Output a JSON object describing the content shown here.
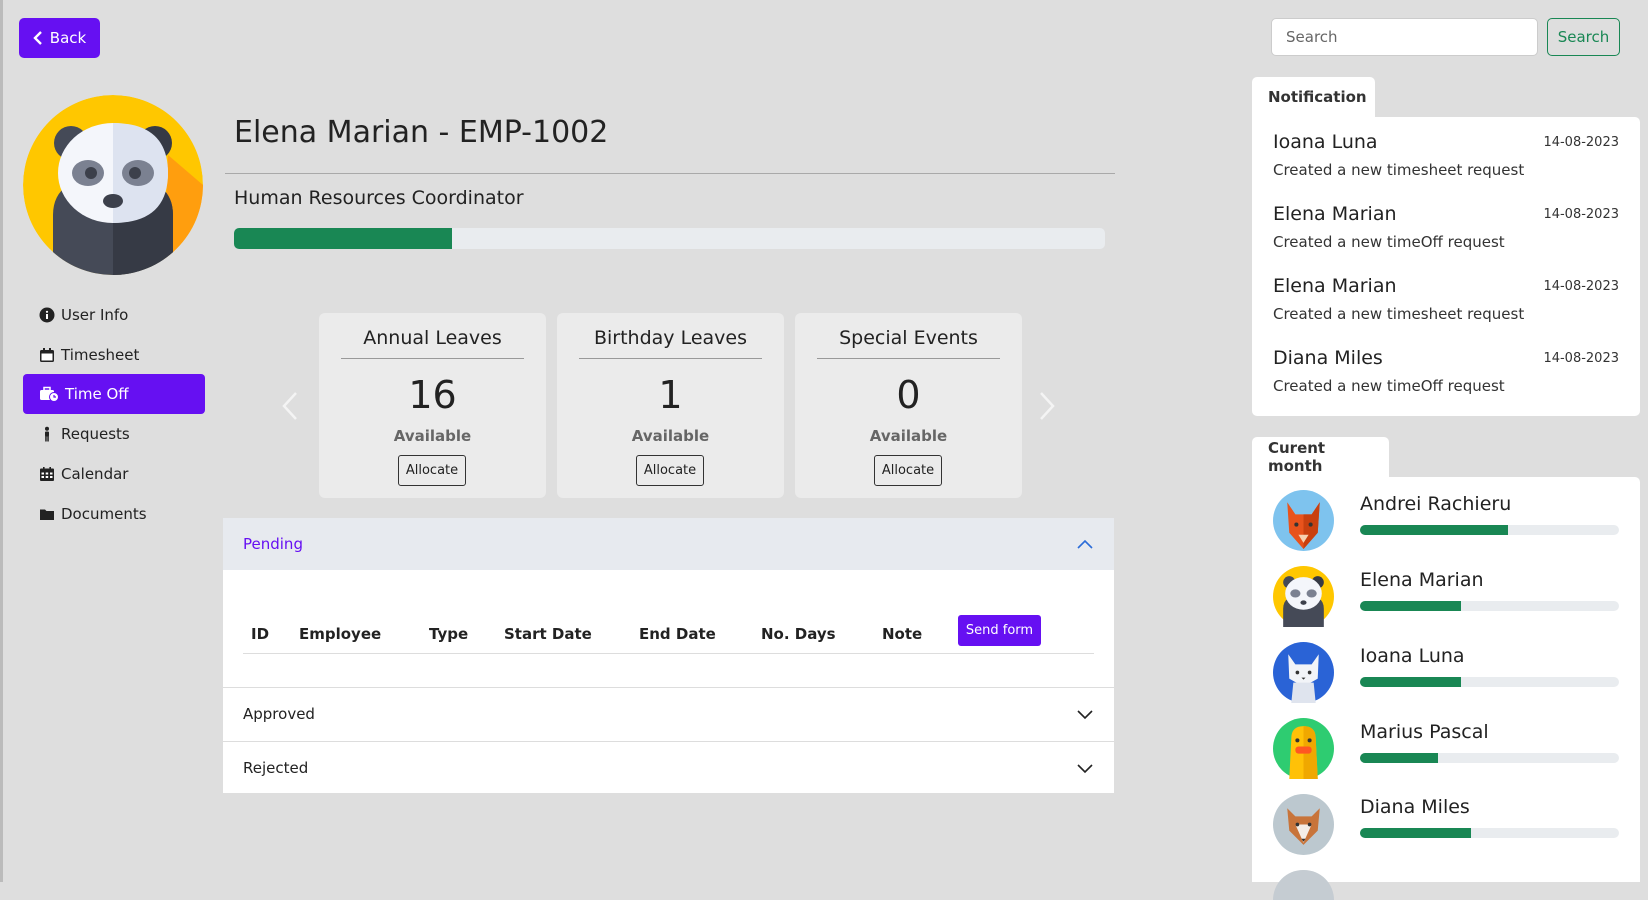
{
  "header": {
    "back_label": "Back",
    "search_placeholder": "Search",
    "search_button": "Search"
  },
  "profile": {
    "name": "Elena Marian - EMP-1002",
    "job_title": "Human Resources Coordinator",
    "progress_percent": 25
  },
  "nav": {
    "items": [
      {
        "label": "User Info",
        "icon": "info-circle-icon"
      },
      {
        "label": "Timesheet",
        "icon": "calendar-icon"
      },
      {
        "label": "Time Off",
        "icon": "briefcase-clock-icon",
        "active": true
      },
      {
        "label": "Requests",
        "icon": "person-icon"
      },
      {
        "label": "Calendar",
        "icon": "calendar-grid-icon"
      },
      {
        "label": "Documents",
        "icon": "folder-icon"
      }
    ]
  },
  "leave_cards": [
    {
      "title": "Annual Leaves",
      "value": "16",
      "sub": "Available",
      "button": "Allocate"
    },
    {
      "title": "Birthday Leaves",
      "value": "1",
      "sub": "Available",
      "button": "Allocate"
    },
    {
      "title": "Special Events",
      "value": "0",
      "sub": "Available",
      "button": "Allocate"
    }
  ],
  "accordion": {
    "pending": "Pending",
    "approved": "Approved",
    "rejected": "Rejected",
    "columns": [
      "ID",
      "Employee",
      "Type",
      "Start Date",
      "End Date",
      "No. Days",
      "Note"
    ],
    "send_form": "Send form"
  },
  "notifications": {
    "tab": "Notification",
    "items": [
      {
        "name": "Ioana Luna",
        "date": "14-08-2023",
        "message": "Created a new timesheet request"
      },
      {
        "name": "Elena Marian",
        "date": "14-08-2023",
        "message": "Created a new timeOff request"
      },
      {
        "name": "Elena Marian",
        "date": "14-08-2023",
        "message": "Created a new timesheet request"
      },
      {
        "name": "Diana Miles",
        "date": "14-08-2023",
        "message": "Created a new timeOff request"
      }
    ]
  },
  "current_month": {
    "tab": "Curent month",
    "members": [
      {
        "name": "Andrei Rachieru",
        "avatar": "fox-avatar-icon",
        "progress_percent": 57
      },
      {
        "name": "Elena Marian",
        "avatar": "panda-avatar-icon",
        "progress_percent": 39
      },
      {
        "name": "Ioana Luna",
        "avatar": "cat-avatar-icon",
        "progress_percent": 39
      },
      {
        "name": "Marius Pascal",
        "avatar": "duck-avatar-icon",
        "progress_percent": 30
      },
      {
        "name": "Diana Miles",
        "avatar": "wolf-avatar-icon",
        "progress_percent": 43
      }
    ]
  },
  "colors": {
    "accent": "#6610f2",
    "success": "#198754",
    "background": "#dedede"
  }
}
